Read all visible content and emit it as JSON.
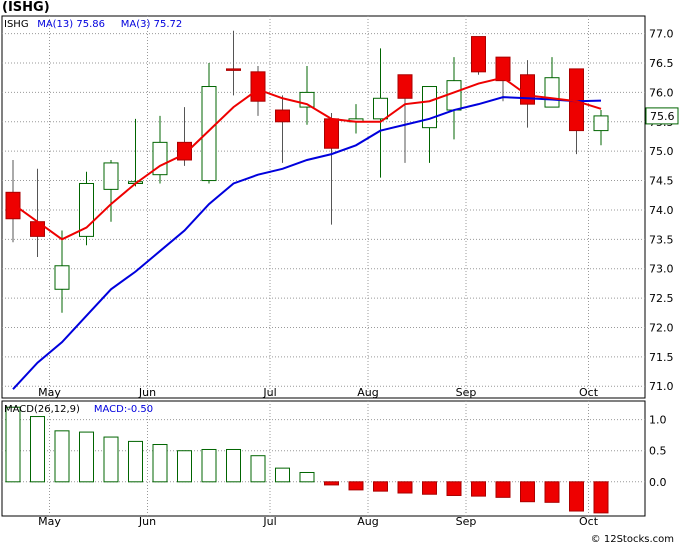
{
  "title": "(ISHG)",
  "watermark": "© 12Stocks.com",
  "colors": {
    "up_fill": "#ffffff",
    "up_stroke": "#006400",
    "down_fill": "#ee0000",
    "ma_fast": "#ee0000",
    "ma_slow": "#0000dd",
    "grid": "#999999",
    "price_box": "#006400"
  },
  "chart_data": [
    {
      "type": "candlestick",
      "legend": [
        {
          "label": "ISHG",
          "color": "#000000"
        },
        {
          "label": "MA(13)",
          "value": "75.86",
          "color": "#0000dd"
        },
        {
          "label": "MA(3)",
          "value": "75.72",
          "color": "#0000dd"
        }
      ],
      "last_price_label": "75.6",
      "ylim": [
        70.8,
        77.3
      ],
      "yticks": [
        "71.0",
        "71.5",
        "72.0",
        "72.5",
        "73.0",
        "73.5",
        "74.0",
        "74.5",
        "75.0",
        "75.5",
        "76.0",
        "76.5",
        "77.0"
      ],
      "xticks": [
        "May",
        "Jun",
        "Jul",
        "Aug",
        "Sep",
        "Oct"
      ],
      "xtick_bars": [
        1,
        5,
        10,
        14,
        18,
        23
      ],
      "candles": [
        {
          "o": 74.3,
          "h": 74.85,
          "l": 73.45,
          "c": 73.85
        },
        {
          "o": 73.8,
          "h": 74.7,
          "l": 73.2,
          "c": 73.55
        },
        {
          "o": 72.65,
          "h": 73.65,
          "l": 72.25,
          "c": 73.05
        },
        {
          "o": 73.55,
          "h": 74.65,
          "l": 73.4,
          "c": 74.45
        },
        {
          "o": 74.35,
          "h": 74.85,
          "l": 73.8,
          "c": 74.8
        },
        {
          "o": 74.45,
          "h": 75.55,
          "l": 74.4,
          "c": 74.48
        },
        {
          "o": 74.6,
          "h": 75.6,
          "l": 74.45,
          "c": 75.15
        },
        {
          "o": 75.15,
          "h": 75.75,
          "l": 74.75,
          "c": 74.85
        },
        {
          "o": 74.5,
          "h": 76.5,
          "l": 74.45,
          "c": 76.1
        },
        {
          "o": 76.4,
          "h": 77.05,
          "l": 75.95,
          "c": 76.38
        },
        {
          "o": 76.35,
          "h": 76.45,
          "l": 75.6,
          "c": 75.85
        },
        {
          "o": 75.7,
          "h": 75.95,
          "l": 74.8,
          "c": 75.5
        },
        {
          "o": 75.75,
          "h": 76.45,
          "l": 75.45,
          "c": 76.0
        },
        {
          "o": 75.55,
          "h": 75.65,
          "l": 73.75,
          "c": 75.05
        },
        {
          "o": 75.5,
          "h": 75.8,
          "l": 75.3,
          "c": 75.55
        },
        {
          "o": 75.55,
          "h": 76.75,
          "l": 74.55,
          "c": 75.9
        },
        {
          "o": 76.3,
          "h": 76.3,
          "l": 74.8,
          "c": 75.9
        },
        {
          "o": 75.4,
          "h": 76.1,
          "l": 74.8,
          "c": 76.1
        },
        {
          "o": 75.7,
          "h": 76.6,
          "l": 75.2,
          "c": 76.2
        },
        {
          "o": 76.95,
          "h": 76.95,
          "l": 76.3,
          "c": 76.35
        },
        {
          "o": 76.6,
          "h": 76.6,
          "l": 75.85,
          "c": 76.2
        },
        {
          "o": 76.3,
          "h": 76.55,
          "l": 75.4,
          "c": 75.8
        },
        {
          "o": 75.75,
          "h": 76.6,
          "l": 75.75,
          "c": 76.25
        },
        {
          "o": 76.4,
          "h": 76.4,
          "l": 74.95,
          "c": 75.35
        },
        {
          "o": 75.35,
          "h": 75.7,
          "l": 75.1,
          "c": 75.6
        }
      ],
      "ma3": [
        74.1,
        73.8,
        73.5,
        73.7,
        74.1,
        74.45,
        74.75,
        74.95,
        75.35,
        75.75,
        76.05,
        75.9,
        75.8,
        75.55,
        75.45,
        75.5,
        75.8,
        75.85,
        76.0,
        76.15,
        76.25,
        75.95,
        75.9,
        75.85,
        75.72
      ],
      "ma13": [
        null,
        null,
        null,
        null,
        null,
        null,
        null,
        null,
        null,
        null,
        null,
        null,
        null,
        null,
        null,
        null,
        null,
        null,
        null,
        null,
        null,
        null,
        null,
        null,
        75.86
      ],
      "ma13_line": [
        [
          0,
          70.95
        ],
        [
          1,
          71.4
        ],
        [
          2,
          71.75
        ],
        [
          3,
          72.2
        ],
        [
          4,
          72.65
        ],
        [
          5,
          72.95
        ],
        [
          6,
          73.3
        ],
        [
          7,
          73.65
        ],
        [
          8,
          74.1
        ],
        [
          9,
          74.45
        ],
        [
          10,
          74.6
        ],
        [
          11,
          74.7
        ],
        [
          12,
          74.85
        ],
        [
          13,
          74.95
        ],
        [
          14,
          75.1
        ],
        [
          15,
          75.35
        ],
        [
          16,
          75.45
        ],
        [
          17,
          75.55
        ],
        [
          18,
          75.7
        ],
        [
          19,
          75.8
        ],
        [
          20,
          75.92
        ],
        [
          21,
          75.9
        ],
        [
          22,
          75.88
        ],
        [
          23,
          75.85
        ],
        [
          24,
          75.86
        ]
      ],
      "ma3_line": [
        [
          0,
          74.1
        ],
        [
          1,
          73.8
        ],
        [
          2,
          73.5
        ],
        [
          3,
          73.7
        ],
        [
          4,
          74.1
        ],
        [
          5,
          74.45
        ],
        [
          6,
          74.75
        ],
        [
          7,
          74.95
        ],
        [
          8,
          75.35
        ],
        [
          9,
          75.75
        ],
        [
          10,
          76.05
        ],
        [
          11,
          75.9
        ],
        [
          12,
          75.8
        ],
        [
          13,
          75.55
        ],
        [
          14,
          75.5
        ],
        [
          15,
          75.5
        ],
        [
          16,
          75.8
        ],
        [
          17,
          75.85
        ],
        [
          18,
          76.0
        ],
        [
          19,
          76.15
        ],
        [
          20,
          76.25
        ],
        [
          21,
          75.95
        ],
        [
          22,
          75.9
        ],
        [
          23,
          75.85
        ],
        [
          24,
          75.72
        ]
      ]
    },
    {
      "type": "bar",
      "legend": [
        {
          "label": "MACD(26,12,9)",
          "color": "#000000"
        },
        {
          "label": "MACD:-0.50",
          "color": "#0000dd"
        }
      ],
      "ylim": [
        -0.55,
        1.3
      ],
      "yticks": [
        "1.0",
        "0.5",
        "0.0"
      ],
      "xticks": [
        "May",
        "Jun",
        "Jul",
        "Aug",
        "Sep",
        "Oct"
      ],
      "values": [
        1.2,
        1.05,
        0.82,
        0.8,
        0.72,
        0.65,
        0.6,
        0.5,
        0.52,
        0.52,
        0.42,
        0.22,
        0.15,
        -0.05,
        -0.13,
        -0.15,
        -0.18,
        -0.2,
        -0.22,
        -0.23,
        -0.25,
        -0.32,
        -0.33,
        -0.47,
        -0.5
      ]
    }
  ]
}
